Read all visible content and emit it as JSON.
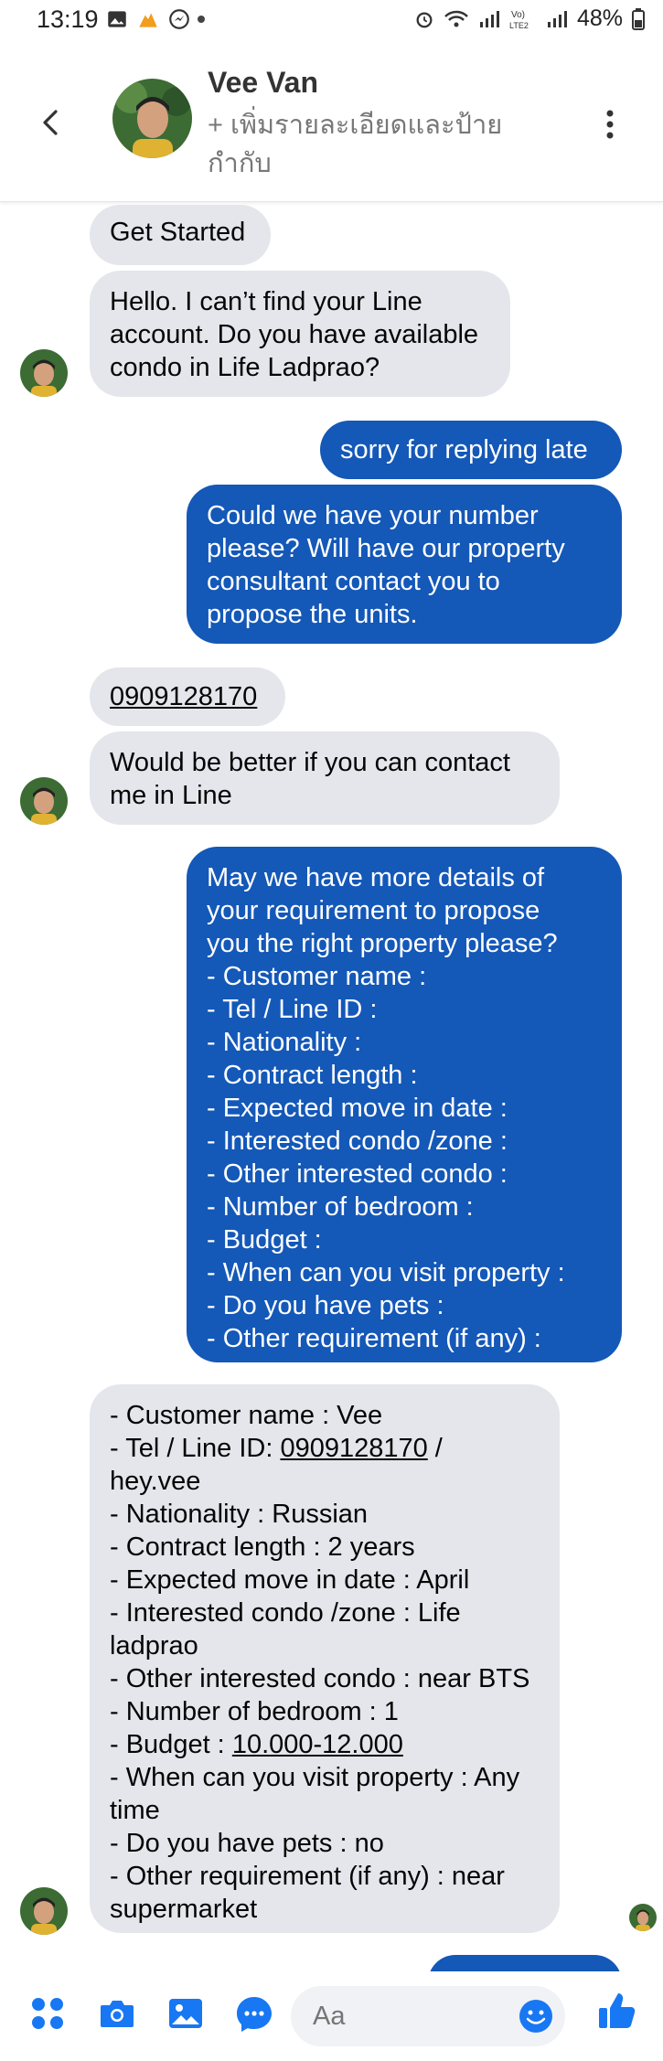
{
  "status": {
    "time": "13:19",
    "battery": "48%"
  },
  "header": {
    "name": "Vee Van",
    "subtitle": "+ เพิ่มรายละเอียดและป้ายกำกับ"
  },
  "messages": [
    {
      "id": "m1",
      "text": "Get Started"
    },
    {
      "id": "m2",
      "text": "Hello. I can’t find your Line\naccount. Do you have available\ncondo in Life Ladprao?"
    },
    {
      "id": "m3",
      "text": "sorry for replying late"
    },
    {
      "id": "m4",
      "text": "Could we have your number\nplease? Will have our property\nconsultant contact you to\npropose the units."
    },
    {
      "id": "m5",
      "text": "0909128170"
    },
    {
      "id": "m6",
      "text": "Would be better if you can contact\nme in Line"
    },
    {
      "id": "m7",
      "text": "May we have more details of\nyour requirement to propose\nyou the right property please?\n- Customer name :\n- Tel / Line ID :\n- Nationality :\n- Contract length :\n- Expected move in date :\n- Interested condo /zone :\n- Other interested condo :\n- Number of bedroom  :\n- Budget :\n- When can you visit property :\n- Do you have pets :\n- Other requirement (if any) :"
    },
    {
      "id": "m8",
      "line1": "- Customer name : Vee",
      "line2a": "- Tel / Line ID: ",
      "phone": "0909128170",
      "line2b": " /\nhey.vee",
      "line3": "- Nationality : Russian\n- Contract length : 2 years\n- Expected move in date : April\n- Interested condo /zone : Life\nladprao\n- Other interested condo : near BTS\n- Number of bedroom  : 1",
      "line4a": "- Budget : ",
      "budget": "10.000-12.000",
      "line5": "- When can you visit property : Any\ntime\n- Do you have pets : no\n- Other requirement (if any) : near\nsupermarket"
    }
  ],
  "composer": {
    "placeholder": "Aa"
  },
  "colors": {
    "outgoing": "#1458b8",
    "incoming": "#e4e6eb",
    "accent": "#1877f2"
  }
}
